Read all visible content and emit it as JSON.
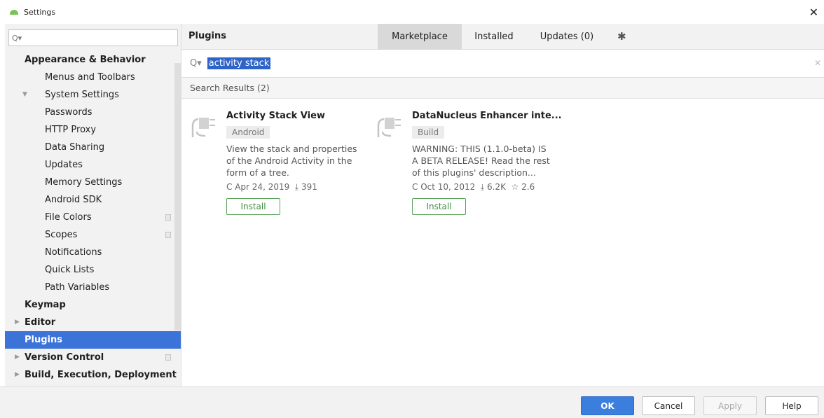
{
  "window": {
    "title": "Settings",
    "close_glyph": "✕"
  },
  "sidebar": {
    "search_glyph": "Q▾",
    "items": [
      {
        "label": "Appearance & Behavior",
        "level": 0,
        "bold": true,
        "arrow": "",
        "project_icon": false
      },
      {
        "label": "Menus and Toolbars",
        "level": 1,
        "bold": false,
        "arrow": "",
        "project_icon": false
      },
      {
        "label": "System Settings",
        "level": 1,
        "bold": false,
        "arrow": "▼",
        "project_icon": false
      },
      {
        "label": "Passwords",
        "level": 2,
        "bold": false,
        "arrow": "",
        "project_icon": false
      },
      {
        "label": "HTTP Proxy",
        "level": 2,
        "bold": false,
        "arrow": "",
        "project_icon": false
      },
      {
        "label": "Data Sharing",
        "level": 2,
        "bold": false,
        "arrow": "",
        "project_icon": false
      },
      {
        "label": "Updates",
        "level": 2,
        "bold": false,
        "arrow": "",
        "project_icon": false
      },
      {
        "label": "Memory Settings",
        "level": 2,
        "bold": false,
        "arrow": "",
        "project_icon": false
      },
      {
        "label": "Android SDK",
        "level": 2,
        "bold": false,
        "arrow": "",
        "project_icon": false
      },
      {
        "label": "File Colors",
        "level": 1,
        "bold": false,
        "arrow": "",
        "project_icon": true
      },
      {
        "label": "Scopes",
        "level": 1,
        "bold": false,
        "arrow": "",
        "project_icon": true
      },
      {
        "label": "Notifications",
        "level": 1,
        "bold": false,
        "arrow": "",
        "project_icon": false
      },
      {
        "label": "Quick Lists",
        "level": 1,
        "bold": false,
        "arrow": "",
        "project_icon": false
      },
      {
        "label": "Path Variables",
        "level": 1,
        "bold": false,
        "arrow": "",
        "project_icon": false
      },
      {
        "label": "Keymap",
        "level": 0,
        "bold": true,
        "arrow": "",
        "project_icon": false
      },
      {
        "label": "Editor",
        "level": 0,
        "bold": true,
        "arrow": "▶",
        "project_icon": false
      },
      {
        "label": "Plugins",
        "level": 0,
        "bold": true,
        "arrow": "",
        "project_icon": false,
        "selected": true
      },
      {
        "label": "Version Control",
        "level": 0,
        "bold": true,
        "arrow": "▶",
        "project_icon": true
      },
      {
        "label": "Build, Execution, Deployment",
        "level": 0,
        "bold": true,
        "arrow": "▶",
        "project_icon": false
      }
    ]
  },
  "header": {
    "title": "Plugins",
    "tabs": [
      {
        "label": "Marketplace",
        "active": true
      },
      {
        "label": "Installed",
        "active": false
      },
      {
        "label": "Updates (0)",
        "active": false
      }
    ],
    "gear_icon": "gear-icon"
  },
  "search": {
    "glyph": "Q▾",
    "query": "activity stack",
    "clear_glyph": "✕"
  },
  "results": {
    "label": "Search Results (2)",
    "plugins": [
      {
        "name": "Activity Stack View",
        "tag": "Android",
        "description": "View the stack and properties of the Android Activity in the form of a tree.",
        "date": "Apr 24, 2019",
        "downloads": "391",
        "rating": "",
        "install_label": "Install"
      },
      {
        "name": "DataNucleus Enhancer inte...",
        "tag": "Build",
        "description": "WARNING: THIS (1.1.0-beta) IS A BETA RELEASE! Read the rest of this plugins' description...",
        "date": "Oct 10, 2012",
        "downloads": "6.2K",
        "rating": "2.6",
        "install_label": "Install"
      }
    ]
  },
  "footer": {
    "ok": "OK",
    "cancel": "Cancel",
    "apply": "Apply",
    "help": "Help"
  },
  "colors": {
    "selection": "#3b73d9",
    "ok_button": "#3b7ede",
    "install_green": "#5aa35a",
    "android_green": "#78c257"
  }
}
